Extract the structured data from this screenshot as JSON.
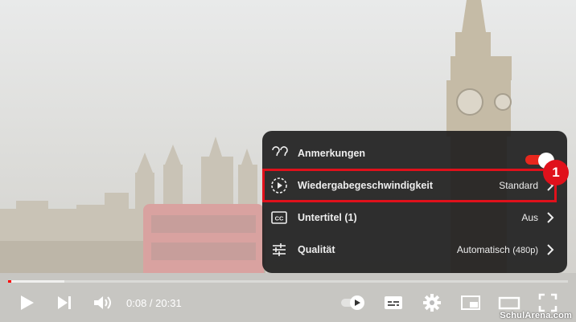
{
  "menu": {
    "items": [
      {
        "label": "Anmerkungen",
        "value": "",
        "icon": "annotations-icon",
        "toggle_on": true
      },
      {
        "label": "Wiedergabegeschwindigkeit",
        "value": "Standard",
        "icon": "playback-speed-icon"
      },
      {
        "label": "Untertitel (1)",
        "value": "Aus",
        "icon": "subtitles-icon"
      },
      {
        "label": "Qualität",
        "value": "Automatisch",
        "value_detail": "(480p)",
        "icon": "quality-icon"
      }
    ]
  },
  "callout": {
    "number": "1"
  },
  "player": {
    "time": "0:08 / 20:31",
    "progress_played": 0.006,
    "progress_buffered": 0.1
  },
  "watermark": "SchulArena.com",
  "colors": {
    "accent": "#e0111b",
    "toggle": "#e8271d",
    "menu_bg": "#1c1c1c"
  }
}
